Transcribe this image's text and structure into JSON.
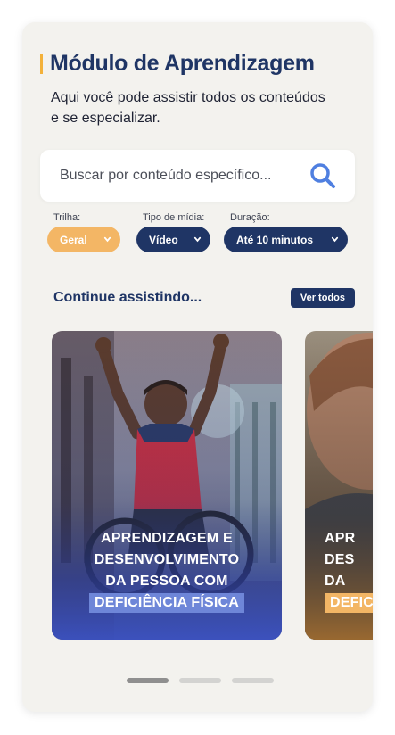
{
  "header": {
    "title": "Módulo de Aprendizagem",
    "subtitle_line1": "Aqui você pode assistir todos os conteúdos",
    "subtitle_line2": "e se especializar."
  },
  "search": {
    "placeholder": "Buscar por conteúdo específico...",
    "value": "",
    "icon": "search-icon"
  },
  "filters": [
    {
      "label": "Trilha:",
      "value": "Geral"
    },
    {
      "label": "Tipo de mídia:",
      "value": "Vídeo"
    },
    {
      "label": "Duração:",
      "value": "Até 10 minutos"
    }
  ],
  "section": {
    "title": "Continue assistindo...",
    "see_all": "Ver todos"
  },
  "cards": [
    {
      "line1": "APRENDIZAGEM E",
      "line2": "DESENVOLVIMENTO",
      "line3": "DA PESSOA COM",
      "highlight": "DEFICIÊNCIA FÍSICA"
    },
    {
      "line1": "APR",
      "line2": "DES",
      "line3": "DA",
      "highlight": "DEFICI"
    }
  ],
  "pagination": {
    "pages": 3,
    "active": 1
  },
  "colors": {
    "navy": "#1f3565",
    "accent_yellow": "#f3b665",
    "highlight_blue": "#6e86d8",
    "search_icon_blue": "#4f7fe0",
    "background": "#f3f2ee"
  }
}
